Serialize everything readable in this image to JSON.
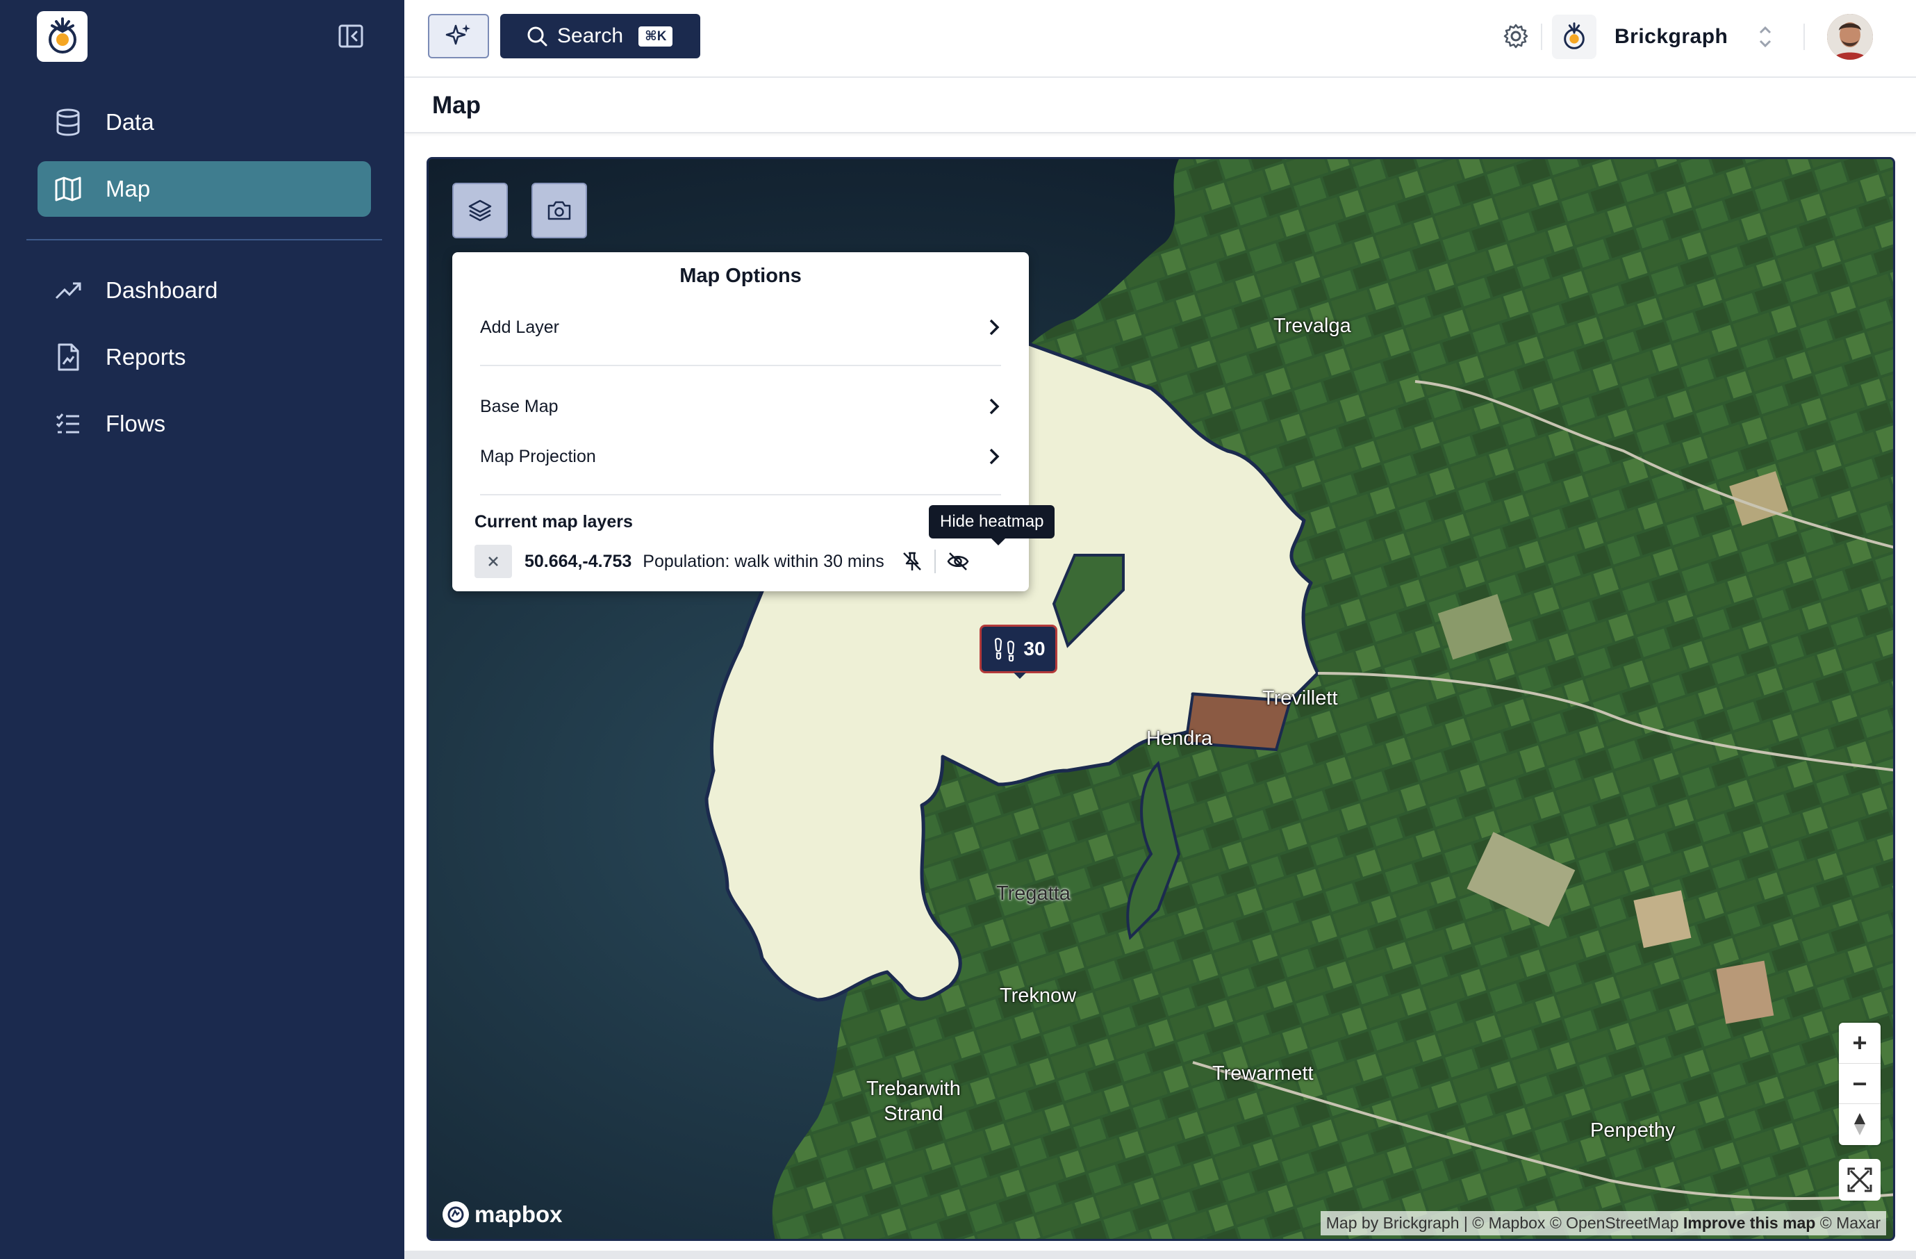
{
  "sidebar": {
    "collapse_label": "",
    "items": [
      {
        "label": "Data",
        "icon": "database-icon"
      },
      {
        "label": "Map",
        "icon": "map-icon",
        "active": true
      },
      {
        "label": "Dashboard",
        "icon": "trending-up-icon"
      },
      {
        "label": "Reports",
        "icon": "report-icon"
      },
      {
        "label": "Flows",
        "icon": "list-checks-icon"
      }
    ]
  },
  "topbar": {
    "search_label": "Search",
    "search_shortcut": "⌘K",
    "org_name": "Brickgraph"
  },
  "page": {
    "title": "Map"
  },
  "map_options": {
    "title": "Map Options",
    "add_layer": "Add Layer",
    "base_map": "Base Map",
    "map_projection": "Map Projection",
    "current_layers_title": "Current map layers",
    "layer": {
      "coords": "50.664,-4.753",
      "name": "Population: walk within 30 mins"
    },
    "tooltip": "Hide heatmap"
  },
  "map": {
    "marker_value": "30",
    "places": {
      "trevalga": "Trevalga",
      "trevillett": "Trevillett",
      "hendra": "Hendra",
      "tregatta": "Tregatta",
      "treknow": "Treknow",
      "trebarwith_line1": "Trebarwith",
      "trebarwith_line2": "Strand",
      "trewarmett": "Trewarmett",
      "penpethy": "Penpethy"
    },
    "zoom_in": "+",
    "zoom_out": "−",
    "mapbox_logo": "mapbox",
    "attribution_text": "Map by Brickgraph | © Mapbox © OpenStreetMap",
    "attribution_improve": "Improve this map",
    "attribution_maxar": "© Maxar"
  },
  "colors": {
    "sidebar_bg": "#1b2a4e",
    "active_nav": "#3f7d8f",
    "accent": "#1b2a4e",
    "isochrone_fill": "#eef0d6"
  }
}
